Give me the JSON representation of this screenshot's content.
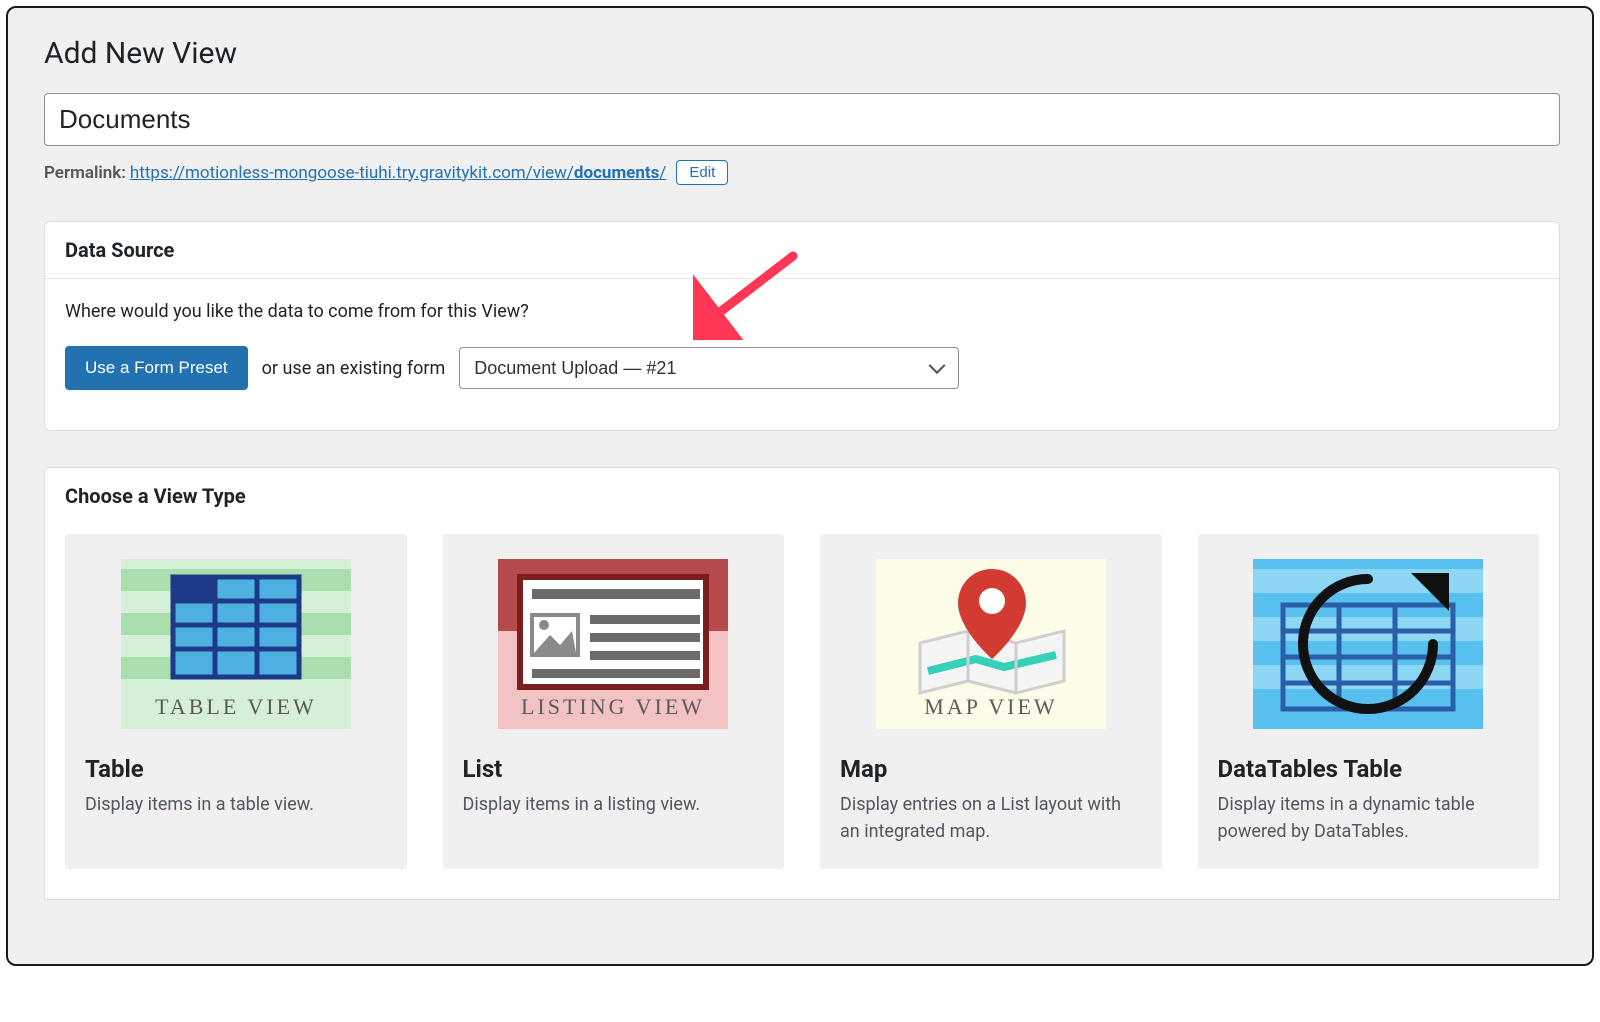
{
  "page": {
    "heading": "Add New View",
    "title_value": "Documents"
  },
  "permalink": {
    "label": "Permalink:",
    "url_base": "https://motionless-mongoose-tiuhi.try.gravitykit.com/view/",
    "url_slug": "documents",
    "url_trailing": "/",
    "edit_label": "Edit"
  },
  "data_source": {
    "panel_title": "Data Source",
    "prompt": "Where would you like the data to come from for this View?",
    "preset_button": "Use a Form Preset",
    "or_label": "or use an existing form",
    "selected_form": "Document Upload — #21"
  },
  "view_types": {
    "panel_title": "Choose a View Type",
    "cards": [
      {
        "title": "Table",
        "desc": "Display items in a table view.",
        "thumb_label": "TABLE VIEW"
      },
      {
        "title": "List",
        "desc": "Display items in a listing view.",
        "thumb_label": "LISTING VIEW"
      },
      {
        "title": "Map",
        "desc": "Display entries on a List layout with an integrated map.",
        "thumb_label": "MAP VIEW"
      },
      {
        "title": "DataTables Table",
        "desc": "Display items in a dynamic table powered by DataTables.",
        "thumb_label": ""
      }
    ]
  }
}
